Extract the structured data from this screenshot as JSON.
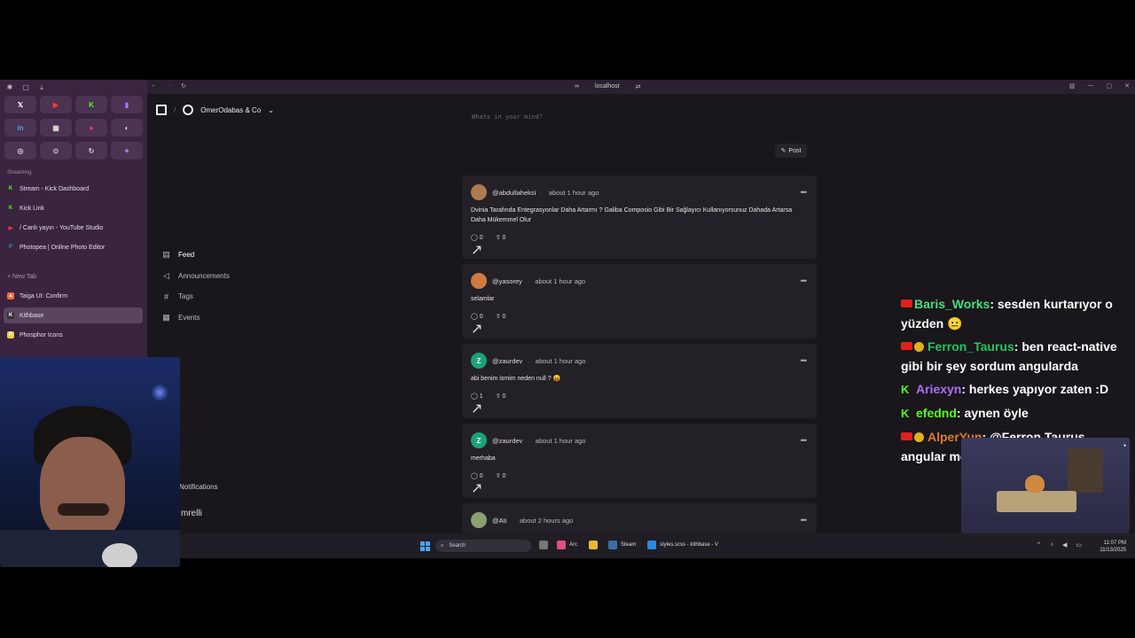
{
  "browser": {
    "url_display": "localhost",
    "url_icon": "link-icon",
    "extra_icon": "swap-icon"
  },
  "arc": {
    "favorites": [
      {
        "icon": "x-icon",
        "glyph": "𝕏",
        "color": "#ffffff"
      },
      {
        "icon": "youtube-icon",
        "glyph": "▶",
        "color": "#ff3b3b"
      },
      {
        "icon": "kick-icon",
        "glyph": "K",
        "color": "#53fc18"
      },
      {
        "icon": "twitch-icon",
        "glyph": "▮",
        "color": "#a970ff"
      },
      {
        "icon": "linkedin-icon",
        "glyph": "in",
        "color": "#4aa3ff"
      },
      {
        "icon": "app-icon",
        "glyph": "▦",
        "color": "#dddddd"
      },
      {
        "icon": "red-app-icon",
        "glyph": "●",
        "color": "#ff3b6b"
      },
      {
        "icon": "mask-icon",
        "glyph": "◐",
        "color": "#dddddd"
      },
      {
        "icon": "settings-icon",
        "glyph": "◎",
        "color": "#cccccc"
      },
      {
        "icon": "circle-icon",
        "glyph": "⊙",
        "color": "#cccccc"
      },
      {
        "icon": "sync-icon",
        "glyph": "↻",
        "color": "#cccccc"
      },
      {
        "icon": "spark-icon",
        "glyph": "✦",
        "color": "#8a8aff"
      }
    ],
    "section_streaming": "Streaming",
    "streaming_tabs": [
      {
        "label": "Stream - Kick Dashboard",
        "icon": "kick-icon",
        "ico_color": "#53fc18",
        "ico_glyph": "K"
      },
      {
        "label": "Kick Link",
        "icon": "link-icon",
        "ico_color": "#53fc18",
        "ico_glyph": "K"
      },
      {
        "label": "/ Canlı yayın - YouTube Studio",
        "icon": "youtube-icon",
        "ico_color": "#ff3b3b",
        "ico_glyph": "▶"
      },
      {
        "label": "Photopea | Online Photo Editor",
        "icon": "photopea-icon",
        "ico_color": "#20a0c0",
        "ico_glyph": "P"
      }
    ],
    "new_tab": "+ New Tab",
    "tabs": [
      {
        "label": "Taiga UI: Confirm",
        "icon": "taiga-icon",
        "ico_color": "#ff6a3d",
        "ico_glyph": "▲",
        "active": false
      },
      {
        "label": "Kithbase",
        "icon": "kithbase-icon",
        "ico_color": "#333333",
        "ico_glyph": "K",
        "active": true
      },
      {
        "label": "Phosphor Icons",
        "icon": "phosphor-icon",
        "ico_color": "#e8d040",
        "ico_glyph": "P",
        "active": false
      }
    ]
  },
  "app": {
    "org_name": "OmerOdabas & Co",
    "composer_placeholder": "Whats in your mind?",
    "post_button": "Post",
    "nav": [
      {
        "label": "Feed",
        "icon": "feed-icon",
        "glyph": "▤",
        "active": true
      },
      {
        "label": "Announcements",
        "icon": "megaphone-icon",
        "glyph": "◁",
        "active": false
      },
      {
        "label": "Tags",
        "icon": "hash-icon",
        "glyph": "#",
        "active": false
      },
      {
        "label": "Events",
        "icon": "calendar-icon",
        "glyph": "▦",
        "active": false
      }
    ],
    "hidden_nav_notifications": "Notifications",
    "hidden_nav_user": "mrelli",
    "posts": [
      {
        "user": "@abdullaheksi",
        "time": "about 1 hour ago",
        "avatar": "photo",
        "avatar_color": "#b07a50",
        "avatar_letter": "",
        "body": "Dvinia Tarafında Entegrasyonlar Daha Artarmı ? Galiba Composio Gibi Bir Sağlayıcı Kullanıyorsunuz Dahada Artarsa Daha Mükemmel Olur",
        "comments": "0",
        "votes": "0"
      },
      {
        "user": "@yasorey",
        "time": "about 1 hour ago",
        "avatar": "photo",
        "avatar_color": "#d07a40",
        "avatar_letter": "",
        "body": "selamlar",
        "comments": "0",
        "votes": "0"
      },
      {
        "user": "@zaurdev",
        "time": "about 1 hour ago",
        "avatar": "letter",
        "avatar_color": "#1aa37a",
        "avatar_letter": "Z",
        "body": "abi benim ismim neden null ? 😝",
        "comments": "1",
        "votes": "0"
      },
      {
        "user": "@zaurdev",
        "time": "about 1 hour ago",
        "avatar": "letter",
        "avatar_color": "#1aa37a",
        "avatar_letter": "Z",
        "body": "merhaba",
        "comments": "0",
        "votes": "0"
      },
      {
        "user": "@Ati",
        "time": "about 2 hours ago",
        "avatar": "photo",
        "avatar_color": "#8aa070",
        "avatar_letter": "",
        "body": "",
        "comments": "",
        "votes": ""
      }
    ]
  },
  "taskbar": {
    "search_placeholder": "Search",
    "apps": [
      {
        "label": "Arc",
        "color": "#e05080"
      },
      {
        "label": "Steam",
        "color": "#3a6ea5"
      },
      {
        "label": "styles.scss - kithbase - V",
        "color": "#2a8ae0"
      }
    ],
    "time": "11:07 PM",
    "date": "11/13/2025"
  },
  "chat": [
    {
      "badges": [
        "youtube"
      ],
      "user": "Baris_Works",
      "user_color": "#4ade80",
      "text": ": sesden kurtarıyor o yüzden 😐"
    },
    {
      "badges": [
        "youtube",
        "gold"
      ],
      "user": "Ferron_Taurus",
      "user_color": "#22c55e",
      "text": ": ben react-native gibi bir şey sordum angularda"
    },
    {
      "badges": [
        "kick"
      ],
      "user": "Ariexyn",
      "user_color": "#b06bff",
      "text": ": herkes yapıyor zaten :D"
    },
    {
      "badges": [
        "kick"
      ],
      "user": "efednd",
      "user_color": "#53fc18",
      "text": ": aynen öyle"
    },
    {
      "badges": [
        "youtube",
        "gold"
      ],
      "user": "AlperYun",
      "user_color": "#e07a2a",
      "text": ": @Ferron Taurus angular mobil aracı sormuştu"
    }
  ]
}
